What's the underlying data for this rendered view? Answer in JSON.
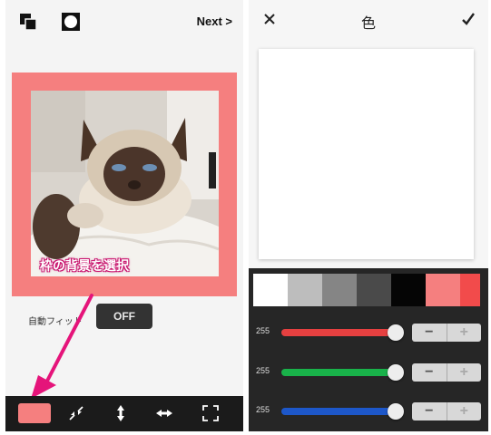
{
  "left_screen": {
    "toolbar": {
      "next_label": "Next >"
    },
    "annotation": {
      "label": "枠の背景を選択"
    },
    "autofit": {
      "label": "自動フィット",
      "toggle_state": "OFF"
    },
    "bottom_bar": {
      "selected_color": "#f57f7f",
      "icons": [
        "shrink-diagonal-icon",
        "vertical-fit-icon",
        "horizontal-fit-icon",
        "fullscreen-icon"
      ]
    },
    "frame_color": "#f57f7f",
    "annotation_color": "#e5147a"
  },
  "right_screen": {
    "title": "色",
    "close_icon": "close-icon",
    "confirm_icon": "checkmark-icon",
    "palette": [
      "#ffffff",
      "#bdbdbd",
      "#858585",
      "#4a4a4a",
      "#050505",
      "#f57f7f",
      "#f24b4b"
    ],
    "sliders": [
      {
        "channel": "red",
        "value": "255",
        "color": "#e64040"
      },
      {
        "channel": "green",
        "value": "255",
        "color": "#19b24a"
      },
      {
        "channel": "blue",
        "value": "255",
        "color": "#1d57c9"
      }
    ],
    "stepper": {
      "minus": "−",
      "plus": "+"
    }
  }
}
